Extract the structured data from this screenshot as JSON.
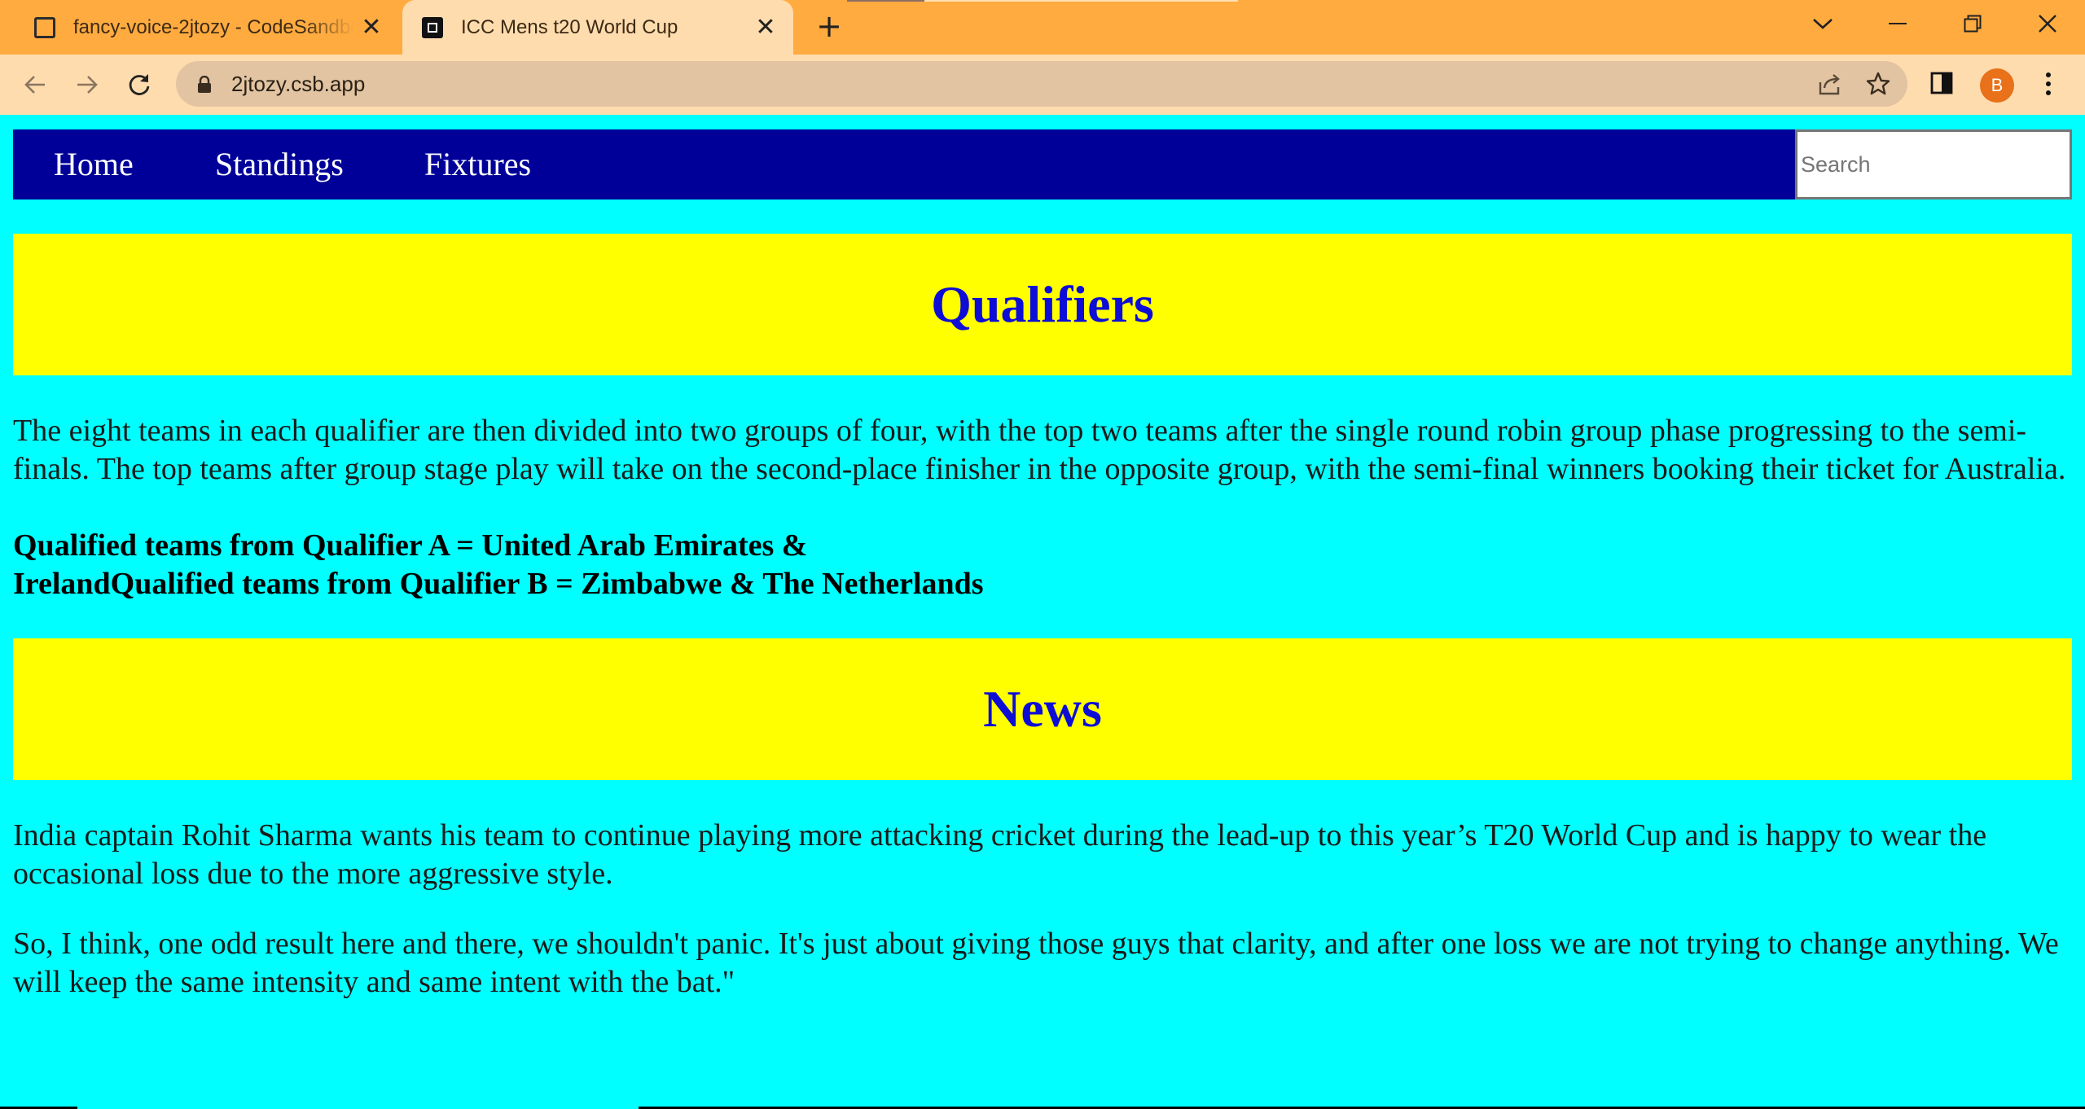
{
  "browser": {
    "tabs": [
      {
        "title": "fancy-voice-2jtozy - CodeSandbox",
        "active": false,
        "close_glyph": "✕"
      },
      {
        "title": "ICC Mens t20 World Cup",
        "active": true,
        "close_glyph": "✕"
      }
    ],
    "new_tab_glyph": "+",
    "url": "2jtozy.csb.app",
    "profile_initial": "B",
    "tabstrip_color": "#ffab40",
    "toolbar_color": "#ffdcae",
    "icons": {
      "back": "arrow-left-icon",
      "forward": "arrow-right-icon",
      "reload": "reload-icon",
      "lock": "lock-icon",
      "share": "share-icon",
      "bookmark": "star-icon",
      "side_panel": "side-panel-icon",
      "menu": "kebab-menu-icon",
      "tab_search": "chevron-down-icon",
      "minimize": "minimize-icon",
      "restore": "restore-icon",
      "close": "close-icon"
    }
  },
  "page": {
    "background_color": "#00ffff",
    "nav": {
      "background_color": "#000099",
      "links": [
        "Home",
        "Standings",
        "Fixtures"
      ],
      "search_placeholder": "Search"
    },
    "sections": [
      {
        "heading": "Qualifiers",
        "paragraph": "The eight teams in each qualifier are then divided into two groups of four, with the top two teams after the single round robin group phase progressing to the semi-finals. The top teams after group stage play will take on the second-place finisher in the opposite group, with the semi-final winners booking their ticket for Australia.",
        "bold_line_1": "Qualified teams from Qualifier A = United Arab Emirates &",
        "bold_line_2": "IrelandQualified teams from Qualifier B = Zimbabwe & The Netherlands"
      },
      {
        "heading": "News",
        "paragraph_1": "India captain Rohit Sharma wants his team to continue playing more attacking cricket during the lead-up to this year’s T20 World Cup and is happy to wear the occasional loss due to the more aggressive style.",
        "paragraph_2": "So, I think, one odd result here and there, we shouldn't panic. It's just about giving those guys that clarity, and after one loss we are not trying to change anything. We will keep the same intensity and same intent with the bat.\""
      }
    ],
    "banner_color": "#ffff00",
    "heading_color": "#0d0dd6"
  }
}
